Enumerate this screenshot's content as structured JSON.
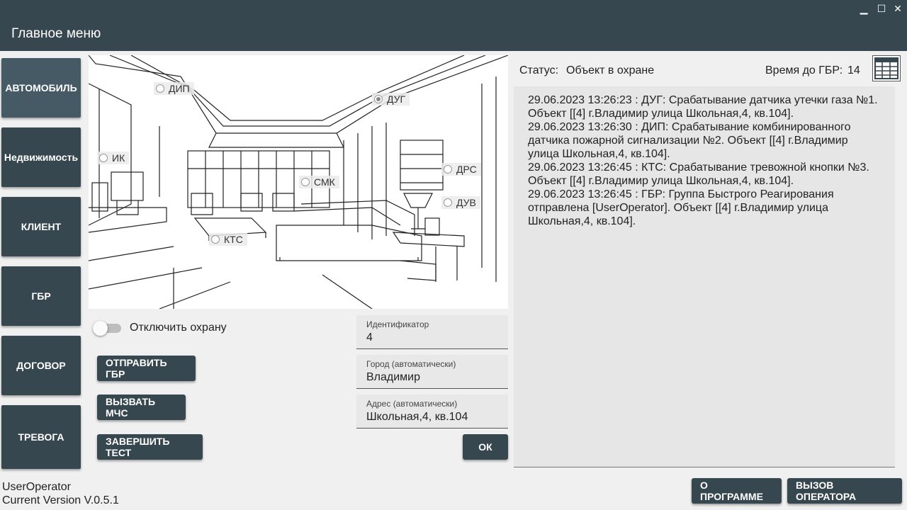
{
  "window": {
    "minimize_glyph": "▁",
    "maximize_glyph": "☐",
    "close_glyph": "✕"
  },
  "header": {
    "title": "Главное меню"
  },
  "sidebar": {
    "items": [
      {
        "label": "АВТОМОБИЛЬ"
      },
      {
        "label": "Недвижимость"
      },
      {
        "label": "КЛИЕНТ"
      },
      {
        "label": "ГБР"
      },
      {
        "label": "ДОГОВОР"
      },
      {
        "label": "ТРЕВОГА"
      }
    ]
  },
  "sensors": [
    {
      "label": "ДИП",
      "selected": false
    },
    {
      "label": "ДУГ",
      "selected": true
    },
    {
      "label": "ИК",
      "selected": false
    },
    {
      "label": "СМК",
      "selected": false
    },
    {
      "label": "ДРС",
      "selected": false
    },
    {
      "label": "ДУВ",
      "selected": false
    },
    {
      "label": "КТС",
      "selected": false
    }
  ],
  "guard_toggle": {
    "label": "Отключить охрану",
    "on": false
  },
  "actions": {
    "send_gbr": "ОТПРАВИТЬ ГБР",
    "call_mchs": "ВЫЗВАТЬ МЧС",
    "finish_test": "ЗАВЕРШИТЬ ТЕСТ",
    "ok": "ОК"
  },
  "fields": {
    "identifier": {
      "label": "Идентификатор",
      "value": "4"
    },
    "city": {
      "label": "Город (автоматически)",
      "value": "Владимир"
    },
    "address": {
      "label": "Адрес (автоматически)",
      "value": "Школьная,4, кв.104"
    }
  },
  "status": {
    "label": "Статус:",
    "value": "Объект в охране",
    "time_label": "Время до ГБР:",
    "time_value": "14"
  },
  "log": {
    "lines": [
      "29.06.2023 13:26:23 : ДУГ: Срабатывание датчика утечки газа №1.",
      "Объект [[4] г.Владимир улица Школьная,4, кв.104].",
      "29.06.2023 13:26:30 : ДИП: Срабатывание комбинированного",
      "датчика пожарной сигнализации №2. Объект [[4] г.Владимир",
      "улица Школьная,4, кв.104].",
      "29.06.2023 13:26:45 : КТС: Срабатывание тревожной кнопки №3.",
      "Объект [[4] г.Владимир улица Школьная,4, кв.104].",
      "29.06.2023 13:26:45 : ГБР: Группа Быстрого Реагирования",
      "отправлена [UserOperator]. Объект [[4] г.Владимир улица",
      "Школьная,4, кв.104]."
    ]
  },
  "footer": {
    "user": "UserOperator",
    "version": "Current Version V.0.5.1",
    "about": "О ПРОГРАММЕ",
    "call_operator": "ВЫЗОВ ОПЕРАТОРА"
  },
  "colors": {
    "primary": "#37474f",
    "background": "#f0f0f0",
    "field_bg": "#e8e8e8",
    "log_bg": "#e6e6e6"
  },
  "icons": {
    "table": "table-grid-icon",
    "scene": "room-interior-drawing"
  }
}
